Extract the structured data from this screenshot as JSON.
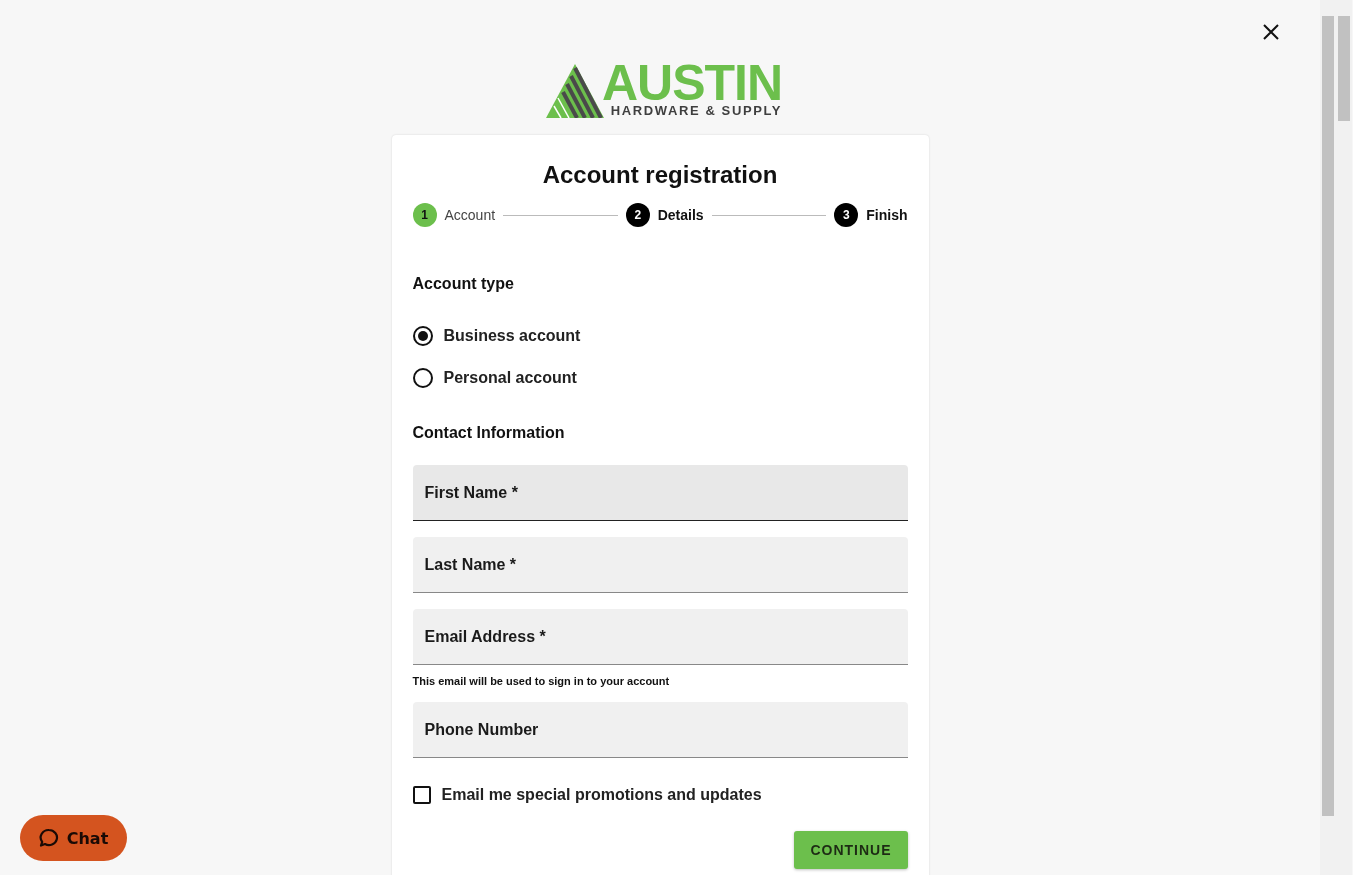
{
  "logo": {
    "name": "AUSTIN",
    "tagline": "HARDWARE & SUPPLY"
  },
  "title": "Account registration",
  "steps": [
    {
      "number": "1",
      "label": "Account",
      "active": true
    },
    {
      "number": "2",
      "label": "Details",
      "active": false
    },
    {
      "number": "3",
      "label": "Finish",
      "active": false
    }
  ],
  "account_type": {
    "heading": "Account type",
    "options": [
      {
        "label": "Business account",
        "selected": true
      },
      {
        "label": "Personal account",
        "selected": false
      }
    ]
  },
  "contact": {
    "heading": "Contact Information",
    "fields": [
      {
        "placeholder": "First Name *",
        "focused": true
      },
      {
        "placeholder": "Last Name *",
        "focused": false
      },
      {
        "placeholder": "Email Address *",
        "focused": false,
        "helper": "This email will be used to sign in to your account"
      },
      {
        "placeholder": "Phone Number",
        "focused": false
      }
    ]
  },
  "promotions": {
    "label": "Email me special promotions and updates",
    "checked": false
  },
  "continue_button": "CONTINUE",
  "chat_button": "Chat"
}
